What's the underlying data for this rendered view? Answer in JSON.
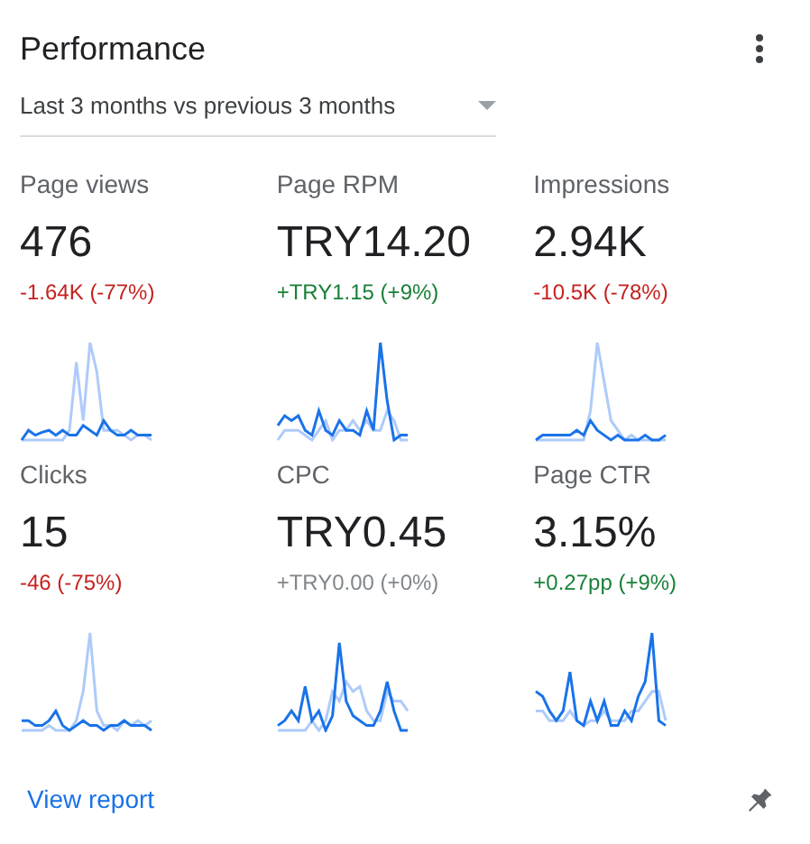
{
  "card": {
    "title": "Performance",
    "period": "Last 3 months vs previous 3 months"
  },
  "metrics": [
    {
      "label": "Page views",
      "value": "476",
      "change": "-1.64K (-77%)",
      "color": "#c5221f"
    },
    {
      "label": "Page RPM",
      "value": "TRY14.20",
      "change": "+TRY1.15 (+9%)",
      "color": "#188038"
    },
    {
      "label": "Impressions",
      "value": "2.94K",
      "change": "-10.5K (-78%)",
      "color": "#c5221f"
    },
    {
      "label": "Clicks",
      "value": "15",
      "change": "-46 (-75%)",
      "color": "#c5221f"
    },
    {
      "label": "CPC",
      "value": "TRY0.45",
      "change": "+TRY0.00 (+0%)",
      "color": "#80868b"
    },
    {
      "label": "Page CTR",
      "value": "3.15%",
      "change": "+0.27pp (+9%)",
      "color": "#188038"
    }
  ],
  "footer": {
    "link": "View report"
  }
}
